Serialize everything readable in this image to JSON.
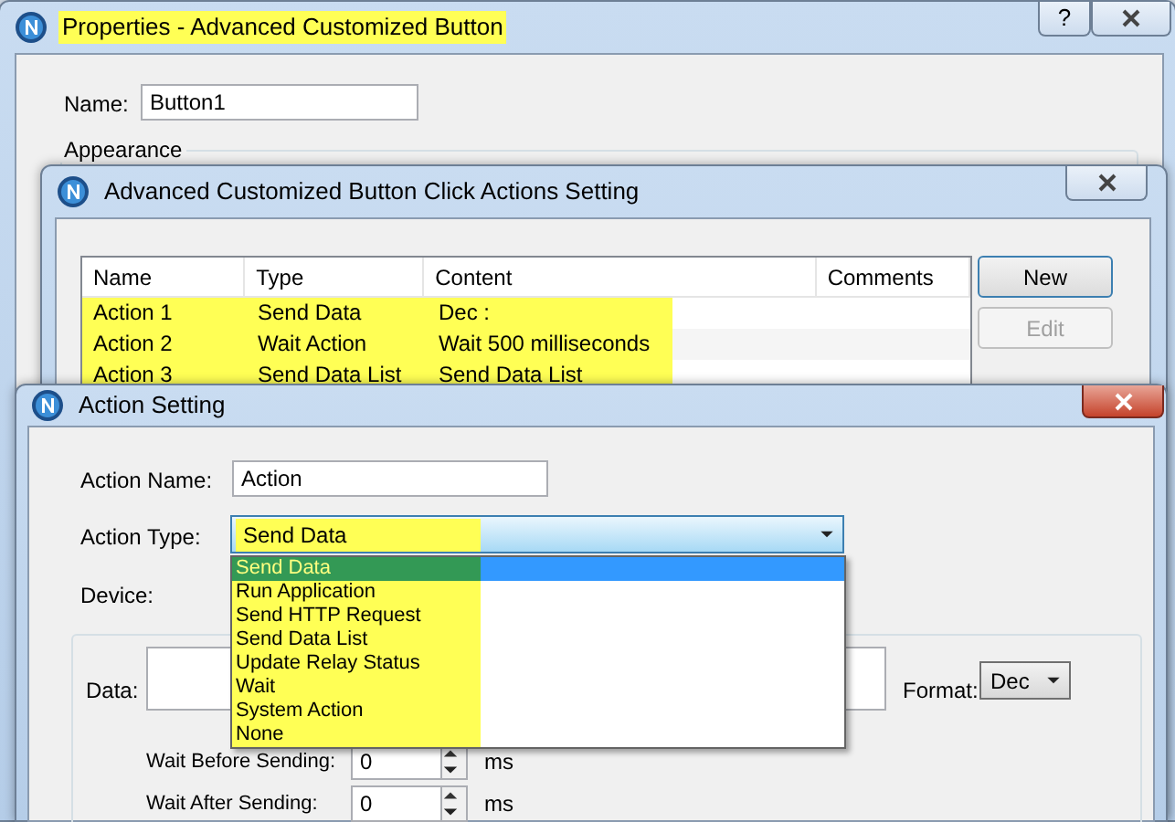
{
  "properties_window": {
    "title": "Properties - Advanced Customized Button",
    "title_highlighted": true,
    "help_button": "?",
    "name_label": "Name:",
    "name_value": "Button1",
    "appearance_label": "Appearance"
  },
  "actions_window": {
    "title": "Advanced Customized Button Click Actions Setting",
    "columns": [
      "Name",
      "Type",
      "Content",
      "Comments"
    ],
    "rows": [
      {
        "cells": [
          "Action 1",
          "Send Data",
          "Dec :"
        ],
        "highlighted": true
      },
      {
        "cells": [
          "Action 2",
          "Wait Action",
          "Wait 500 milliseconds"
        ],
        "highlighted": true
      },
      {
        "cells": [
          "Action 3",
          "Send Data List",
          "Send Data List"
        ],
        "highlighted": true
      }
    ],
    "buttons": [
      {
        "label": "New",
        "disabled": false
      },
      {
        "label": "Edit",
        "disabled": true
      }
    ]
  },
  "action_setting_window": {
    "title": "Action Setting",
    "action_name_label": "Action Name:",
    "action_name_value": "Action",
    "action_type_label": "Action Type:",
    "action_type_value": "Send Data",
    "action_type_highlighted": true,
    "device_label": "Device:",
    "dropdown": {
      "highlighted": true,
      "options": [
        {
          "label": "Send Data",
          "selected": true
        },
        {
          "label": "Run Application",
          "selected": false
        },
        {
          "label": "Send HTTP Request",
          "selected": false
        },
        {
          "label": "Send Data List",
          "selected": false
        },
        {
          "label": "Update Relay Status",
          "selected": false
        },
        {
          "label": "Wait",
          "selected": false
        },
        {
          "label": "System Action",
          "selected": false
        },
        {
          "label": "None",
          "selected": false
        }
      ]
    },
    "data_label": "Data:",
    "format_label": "Format:",
    "format_value": "Dec",
    "wait_before_label": "Wait Before Sending:",
    "wait_before_value": "0",
    "wait_before_unit": "ms",
    "wait_after_label": "Wait After Sending:",
    "wait_after_value": "0",
    "wait_after_unit": "ms"
  }
}
